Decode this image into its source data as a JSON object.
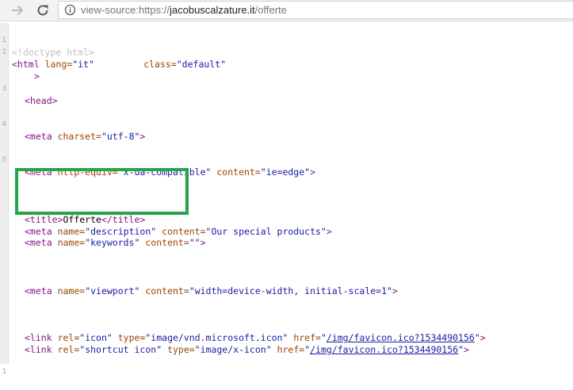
{
  "browser": {
    "url_prefix": "view-source:https://",
    "url_host": "jacobuscalzature.it",
    "url_path": "/offerte"
  },
  "colors": {
    "tag": "#881280",
    "attribute_name": "#994500",
    "attribute_value": "#1a1aa6",
    "comment": "#c0c0c0",
    "highlight_box": "#27a34a"
  },
  "source": {
    "line_numbers": [
      "1",
      "2",
      "",
      "3",
      "4",
      "5",
      "",
      "",
      "",
      "",
      "",
      "",
      "1"
    ],
    "doctype": "<!doctype html>",
    "html_open": "<html",
    "html_lang_attr": "lang=",
    "html_lang_val": "\"it\"",
    "html_class_attr": "class=",
    "html_class_val": "\"default\"",
    "html_close": ">",
    "head": "<head>",
    "meta": "<meta",
    "charset_attr": "charset=",
    "charset_val": "\"utf-8\"",
    "close": ">",
    "http_equiv_attr": "http-equiv=",
    "http_equiv_val": "\"x-ua-compatible\"",
    "content_attr": "content=",
    "ie_edge_val": "\"ie=edge\"",
    "title_open": "<title>",
    "title_text": "Offerte",
    "title_close": "</title>",
    "name_attr": "name=",
    "description_val": "\"description\"",
    "description_content_val": "\"Our special products\"",
    "keywords_val": "\"keywords\"",
    "empty_val": "\"\"",
    "viewport_val": "\"viewport\"",
    "viewport_content_val": "\"width=device-width, initial-scale=1\"",
    "link": "<link",
    "rel_attr": "rel=",
    "icon_val": "\"icon\"",
    "shortcut_icon_val": "\"shortcut icon\"",
    "type_attr": "type=",
    "vnd_icon_val": "\"image/vnd.microsoft.icon\"",
    "x_icon_val": "\"image/x-icon\"",
    "href_attr": "href=",
    "quote": "\"",
    "favicon_href": "/img/favicon.ico?1534490156"
  }
}
